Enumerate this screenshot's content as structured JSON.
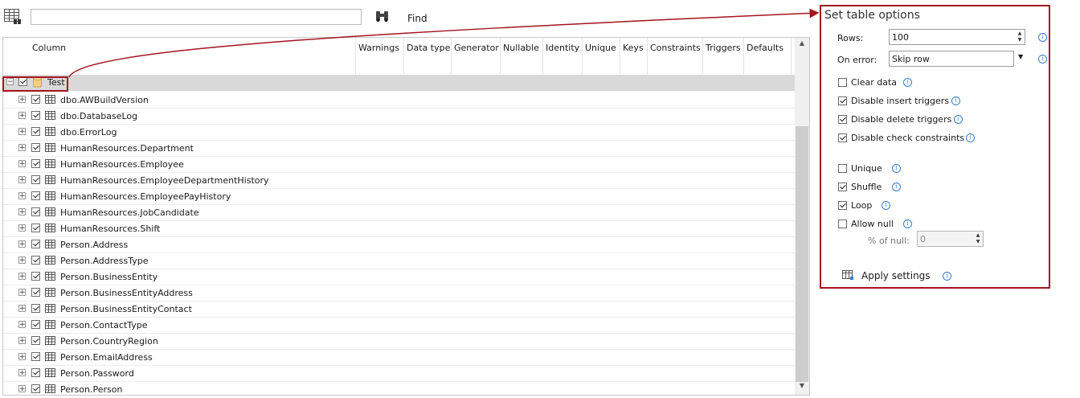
{
  "toolbar": {
    "search_value": "",
    "find_label": "Find",
    "table_icon": "table-options-icon",
    "find_icon": "binoculars-icon"
  },
  "grid": {
    "columns": [
      "Column",
      "Warnings",
      "Data type",
      "Generator",
      "Nullable",
      "Identity",
      "Unique",
      "Keys",
      "Constraints",
      "Triggers",
      "Defaults"
    ],
    "root": {
      "label": "Test",
      "expander": "−",
      "checked": true,
      "icon": "database-icon"
    },
    "rows": [
      {
        "label": "dbo.AWBuildVersion",
        "checked": true
      },
      {
        "label": "dbo.DatabaseLog",
        "checked": true
      },
      {
        "label": "dbo.ErrorLog",
        "checked": true
      },
      {
        "label": "HumanResources.Department",
        "checked": true
      },
      {
        "label": "HumanResources.Employee",
        "checked": true
      },
      {
        "label": "HumanResources.EmployeeDepartmentHistory",
        "checked": true
      },
      {
        "label": "HumanResources.EmployeePayHistory",
        "checked": true
      },
      {
        "label": "HumanResources.JobCandidate",
        "checked": true
      },
      {
        "label": "HumanResources.Shift",
        "checked": true
      },
      {
        "label": "Person.Address",
        "checked": true
      },
      {
        "label": "Person.AddressType",
        "checked": true
      },
      {
        "label": "Person.BusinessEntity",
        "checked": true
      },
      {
        "label": "Person.BusinessEntityAddress",
        "checked": true
      },
      {
        "label": "Person.BusinessEntityContact",
        "checked": true
      },
      {
        "label": "Person.ContactType",
        "checked": true
      },
      {
        "label": "Person.CountryRegion",
        "checked": true
      },
      {
        "label": "Person.EmailAddress",
        "checked": true
      },
      {
        "label": "Person.Password",
        "checked": true
      },
      {
        "label": "Person.Person",
        "checked": true
      }
    ],
    "expander_symbol": "+"
  },
  "options": {
    "title": "Set table options",
    "rows_label": "Rows:",
    "rows_value": "100",
    "on_error_label": "On error:",
    "on_error_value": "Skip row",
    "checkboxes": [
      {
        "label": "Clear data",
        "checked": false
      },
      {
        "label": "Disable insert triggers",
        "checked": true
      },
      {
        "label": "Disable delete triggers",
        "checked": true
      },
      {
        "label": "Disable check constraints",
        "checked": true
      }
    ],
    "column_options": [
      {
        "label": "Unique",
        "checked": false
      },
      {
        "label": "Shuffle",
        "checked": true
      },
      {
        "label": "Loop",
        "checked": true
      },
      {
        "label": "Allow null",
        "checked": false
      }
    ],
    "percent_null_label": "% of null:",
    "percent_null_value": "0",
    "apply_label": "Apply settings",
    "info_icon": "info-icon"
  },
  "colors": {
    "highlight_border": "#a4141e",
    "root_row_bg": "#d9d9d9",
    "info_blue": "#3b7dc4"
  }
}
